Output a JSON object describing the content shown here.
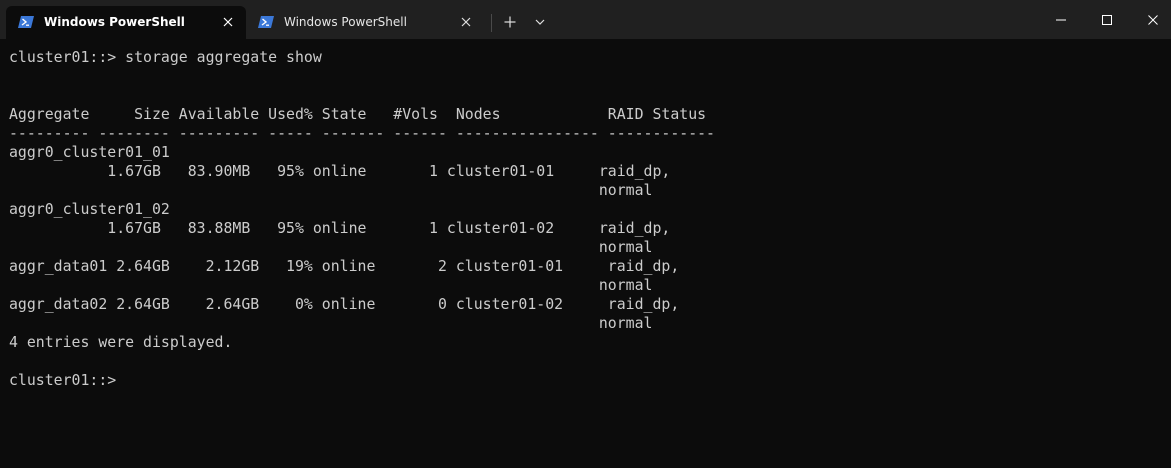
{
  "tabs": [
    {
      "label": "Windows PowerShell",
      "active": true,
      "icon": "powershell-icon"
    },
    {
      "label": "Windows PowerShell",
      "active": false,
      "icon": "powershell-icon"
    }
  ],
  "titlebar": {
    "new_tab_symbol": "+",
    "colors": {
      "titlebar_bg": "#202020",
      "terminal_bg": "#0c0c0c",
      "terminal_fg": "#cccccc",
      "ps_icon_blue": "#3b78d8"
    }
  },
  "terminal": {
    "lines": [
      "cluster01::> storage aggregate show",
      "",
      "",
      "Aggregate     Size Available Used% State   #Vols  Nodes            RAID Status",
      "--------- -------- --------- ----- ------- ------ ---------------- ------------",
      "aggr0_cluster01_01",
      "           1.67GB   83.90MB   95% online       1 cluster01-01     raid_dp,",
      "                                                                  normal",
      "aggr0_cluster01_02",
      "           1.67GB   83.88MB   95% online       1 cluster01-02     raid_dp,",
      "                                                                  normal",
      "aggr_data01 2.64GB    2.12GB   19% online       2 cluster01-01     raid_dp,",
      "                                                                  normal",
      "aggr_data02 2.64GB    2.64GB    0% online       0 cluster01-02     raid_dp,",
      "                                                                  normal",
      "4 entries were displayed.",
      "",
      "cluster01::> "
    ]
  }
}
